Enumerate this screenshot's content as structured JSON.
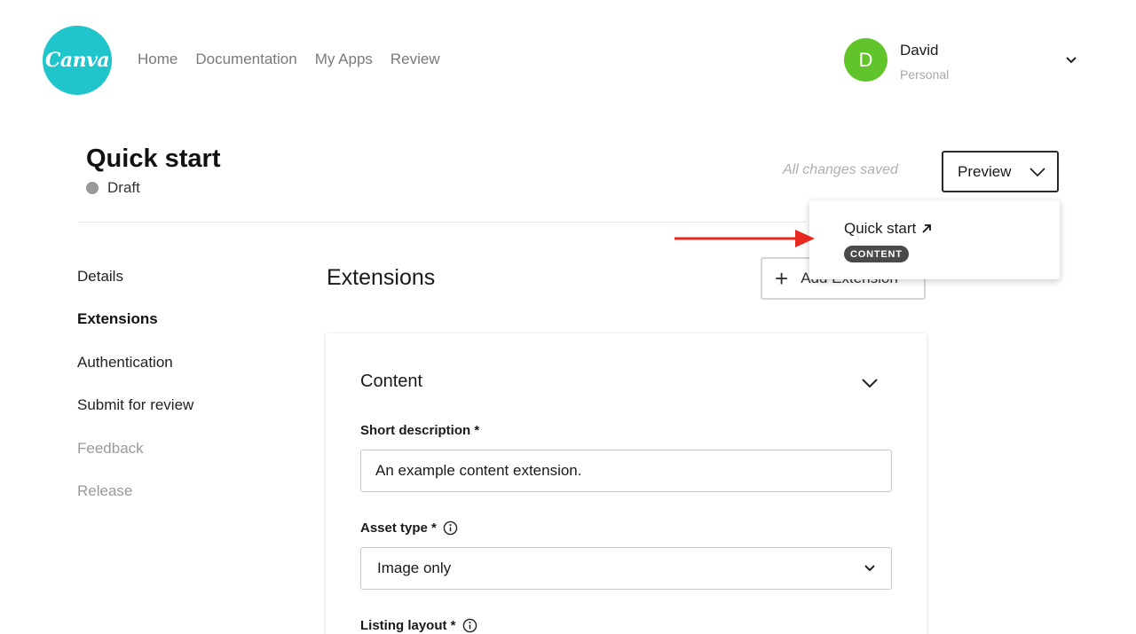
{
  "header": {
    "logo_text": "Canva",
    "nav": [
      "Home",
      "Documentation",
      "My Apps",
      "Review"
    ],
    "user": {
      "initial": "D",
      "name": "David",
      "account_type": "Personal",
      "avatar_color": "#62c42b"
    }
  },
  "page": {
    "title": "Quick start",
    "status": "Draft",
    "save_status": "All changes saved",
    "preview_label": "Preview"
  },
  "sidebar": {
    "items": [
      {
        "label": "Details",
        "state": "normal"
      },
      {
        "label": "Extensions",
        "state": "active"
      },
      {
        "label": "Authentication",
        "state": "normal"
      },
      {
        "label": "Submit for review",
        "state": "normal"
      },
      {
        "label": "Feedback",
        "state": "disabled"
      },
      {
        "label": "Release",
        "state": "disabled"
      }
    ]
  },
  "main": {
    "heading": "Extensions",
    "add_button": "Add Extension",
    "card": {
      "title": "Content",
      "short_description_label": "Short description *",
      "short_description_value": "An example content extension.",
      "asset_type_label": "Asset type *",
      "asset_type_value": "Image only",
      "listing_layout_label": "Listing layout *"
    }
  },
  "preview_menu": {
    "item_label": "Quick start",
    "item_badge": "CONTENT"
  },
  "colors": {
    "brand": "#20c4cb",
    "annotation_arrow": "#e8271e"
  }
}
